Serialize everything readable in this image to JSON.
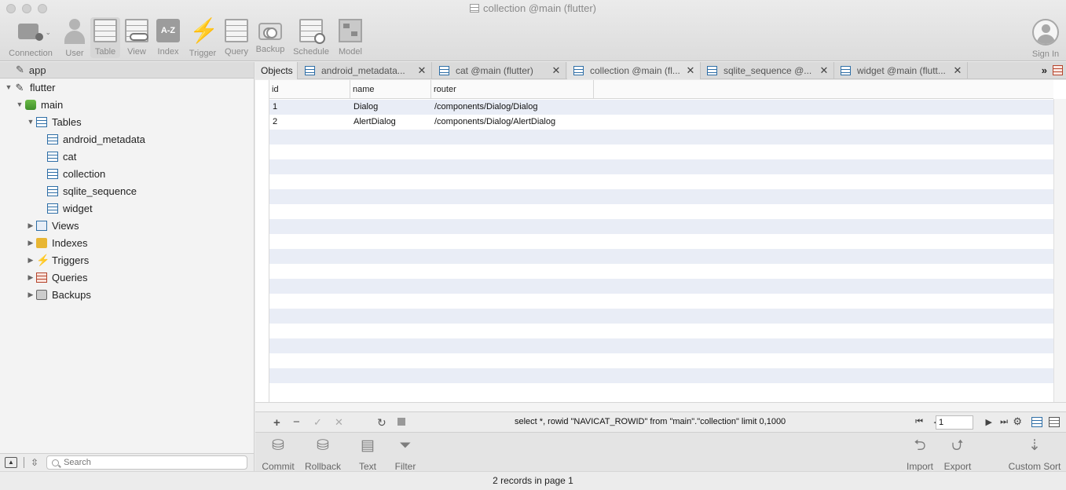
{
  "window": {
    "title": "collection @main (flutter)"
  },
  "toolbar": {
    "connection": "Connection",
    "user": "User",
    "table": "Table",
    "view": "View",
    "index": "Index",
    "trigger": "Trigger",
    "query": "Query",
    "backup": "Backup",
    "schedule": "Schedule",
    "model": "Model",
    "sign_in": "Sign In"
  },
  "sidebar": {
    "header": "app",
    "connection": "flutter",
    "database": "main",
    "tables_group": "Tables",
    "tables": [
      "android_metadata",
      "cat",
      "collection",
      "sqlite_sequence",
      "widget"
    ],
    "groups": [
      "Views",
      "Indexes",
      "Triggers",
      "Queries",
      "Backups"
    ]
  },
  "search": {
    "placeholder": "Search"
  },
  "tabs": {
    "objects": "Objects",
    "items": [
      "android_metadata...",
      "cat @main (flutter)",
      "collection @main (fl...",
      "sqlite_sequence @...",
      "widget @main (flutt..."
    ]
  },
  "grid": {
    "columns": [
      "id",
      "name",
      "router"
    ],
    "rows": [
      [
        "1",
        "Dialog",
        "/components/Dialog/Dialog"
      ],
      [
        "2",
        "AlertDialog",
        "/components/Dialog/AlertDialog"
      ]
    ]
  },
  "status": {
    "sql": "select *, rowid \"NAVICAT_ROWID\" from \"main\".\"collection\"  limit 0,1000",
    "page": "1"
  },
  "bottom_toolbar": {
    "commit": "Commit",
    "rollback": "Rollback",
    "text": "Text",
    "filter": "Filter",
    "import": "Import",
    "export": "Export",
    "custom_sort": "Custom Sort"
  },
  "footer": {
    "records": "2 records in page 1"
  }
}
